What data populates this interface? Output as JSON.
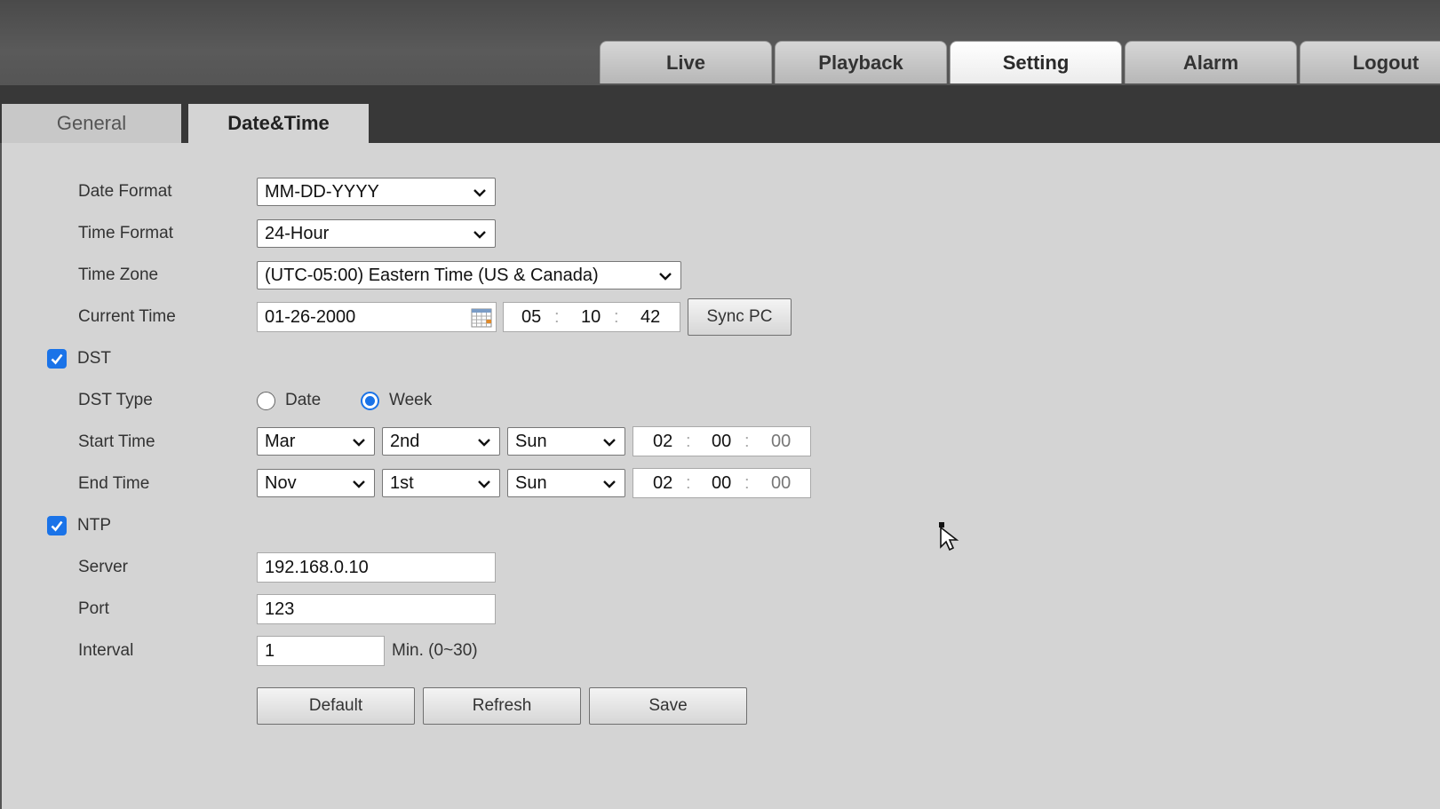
{
  "nav": {
    "tabs": [
      {
        "label": "Live"
      },
      {
        "label": "Playback"
      },
      {
        "label": "Setting"
      },
      {
        "label": "Alarm"
      },
      {
        "label": "Logout"
      }
    ],
    "active": "Setting"
  },
  "subnav": {
    "general": "General",
    "datetime": "Date&Time"
  },
  "form": {
    "date_format": {
      "label": "Date Format",
      "value": "MM-DD-YYYY"
    },
    "time_format": {
      "label": "Time Format",
      "value": "24-Hour"
    },
    "time_zone": {
      "label": "Time Zone",
      "value": "(UTC-05:00) Eastern Time (US & Canada)"
    },
    "current_time": {
      "label": "Current Time",
      "date": "01-26-2000",
      "hour": "05",
      "minute": "10",
      "second": "42",
      "sync_label": "Sync PC"
    },
    "dst": {
      "label": "DST",
      "checked": true
    },
    "dst_type": {
      "label": "DST Type",
      "option_date": "Date",
      "option_week": "Week",
      "selected": "Week"
    },
    "start_time": {
      "label": "Start Time",
      "month": "Mar",
      "week": "2nd",
      "day": "Sun",
      "hour": "02",
      "minute": "00",
      "second": "00"
    },
    "end_time": {
      "label": "End Time",
      "month": "Nov",
      "week": "1st",
      "day": "Sun",
      "hour": "02",
      "minute": "00",
      "second": "00"
    },
    "ntp": {
      "label": "NTP",
      "checked": true
    },
    "server": {
      "label": "Server",
      "value": "192.168.0.10"
    },
    "port": {
      "label": "Port",
      "value": "123"
    },
    "interval": {
      "label": "Interval",
      "value": "1",
      "unit": "Min. (0~30)"
    }
  },
  "buttons": {
    "default": "Default",
    "refresh": "Refresh",
    "save": "Save"
  },
  "time_separator": ":",
  "colors": {
    "accent": "#1a73e8",
    "background": "#d4d4d4",
    "header": "#383838"
  }
}
